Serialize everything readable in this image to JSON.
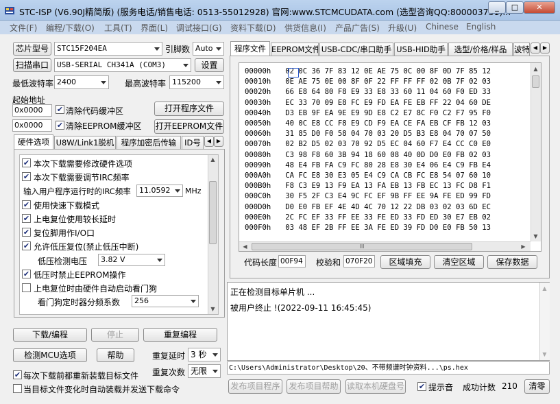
{
  "window": {
    "title": "STC-ISP (V6.90J精简版) (服务电话/销售电话: 0513-55012928) 官网:www.STCMCUDATA.com  (选型咨询QQ:800003751)..."
  },
  "menu": [
    "文件(F)",
    "编程/下载(O)",
    "工具(T)",
    "界面(L)",
    "调试接口(G)",
    "资料下载(D)",
    "供货信息(I)",
    "产品广告(S)",
    "升级(U)",
    "Chinese",
    "English"
  ],
  "left": {
    "chip_model_button": "芯片型号",
    "chip_model_value": "STC15F204EA",
    "pin_count_label": "引脚数",
    "pin_count_value": "Auto",
    "scan_port_button": "扫描串口",
    "port_value": "USB-SERIAL CH341A (COM3)",
    "settings_button": "设置",
    "min_baud_label": "最低波特率",
    "min_baud_value": "2400",
    "max_baud_label": "最高波特率",
    "max_baud_value": "115200",
    "start_addr_label": "起始地址",
    "code_addr": "0x0000",
    "clear_code_label": "清除代码缓冲区",
    "open_program_button": "打开程序文件",
    "eeprom_addr": "0x0000",
    "clear_eeprom_label": "清除EEPROM缓冲区",
    "open_eeprom_button": "打开EEPROM文件",
    "tabs": [
      "硬件选项",
      "U8W/Link1脱机",
      "程序加密后传输",
      "ID号"
    ],
    "options": {
      "opt1": "本次下载需要修改硬件选项",
      "opt2": "本次下载需要调节IRC频率",
      "irc_label": "输入用户程序运行时的IRC频率",
      "irc_value": "11.0592",
      "irc_unit": "MHz",
      "opt3": "使用快速下载模式",
      "opt4": "上电复位使用较长延时",
      "opt5": "复位脚用作I/O口",
      "opt6": "允许低压复位(禁止低压中断)",
      "lv_label": "低压检测电压",
      "lv_value": "3.82 V",
      "opt7": "低压时禁止EEPROM操作",
      "opt8": "上电复位时由硬件自动启动看门狗",
      "wdt_label": "看门狗定时器分频系数",
      "wdt_value": "256"
    },
    "download_button": "下载/编程",
    "stop_button": "停止",
    "reprogram_button": "重复编程",
    "check_mcu_button": "检测MCU选项",
    "help_button": "帮助",
    "repeat_delay_label": "重复延时",
    "repeat_delay_value": "3 秒",
    "repeat_count_label": "重复次数",
    "repeat_count_value": "无限",
    "reload_label": "每次下载前都重新装载目标文件",
    "auto_load_label": "当目标文件变化时自动装载并发送下载命令"
  },
  "right": {
    "tabs": [
      "程序文件",
      "EEPROM文件",
      "USB-CDC/串口助手",
      "USB-HID助手",
      "选型/价格/样品",
      "波特"
    ],
    "hex": {
      "rows": [
        [
          "00000h",
          "02 0C 36 7F 83 12 0E AE 75 0C 00 8F 0D 7F 85 12"
        ],
        [
          "00010h",
          "0E AE 75 0E 00 8F 0F 22 FF FF FF 02 0B 7F 02 03"
        ],
        [
          "00020h",
          "66 E8 64 80 F8 E9 33 E8 33 60 11 04 60 F0 ED 33"
        ],
        [
          "00030h",
          "EC 33 70 09 E8 FC E9 FD EA FE EB FF 22 04 60 DE"
        ],
        [
          "00040h",
          "D3 EB 9F EA 9E E9 9D E8 C2 E7 8C F0 C2 F7 95 F0"
        ],
        [
          "00050h",
          "40 0C E8 CC F8 E9 CD F9 EA CE FA EB CF FB 12 03"
        ],
        [
          "00060h",
          "31 85 D0 F0 58 04 70 03 20 D5 B3 E8 04 70 07 50"
        ],
        [
          "00070h",
          "02 B2 D5 02 03 70 92 D5 EC 04 60 F7 E4 CC C0 E0"
        ],
        [
          "00080h",
          "C3 98 F8 60 3B 94 18 60 08 40 0D D0 E0 FB 02 03"
        ],
        [
          "00090h",
          "48 E4 FB FA C9 FC 80 28 E8 30 E4 06 E4 C9 FB E4"
        ],
        [
          "000A0h",
          "CA FC E8 30 E3 05 E4 C9 CA CB FC E8 54 07 60 10"
        ],
        [
          "000B0h",
          "F8 C3 E9 13 F9 EA 13 FA EB 13 FB EC 13 FC D8 F1"
        ],
        [
          "000C0h",
          "30 F5 2F C3 E4 9C FC EF 9B FF EE 9A FE ED 99 FD"
        ],
        [
          "000D0h",
          "D0 E0 FB EF 4E 4D 4C 70 12 22 DB 03 02 03 6D EC"
        ],
        [
          "000E0h",
          "2C FC EF 33 FF EE 33 FE ED 33 FD ED 30 E7 EB 02"
        ],
        [
          "000F0h",
          "03 48 EF 2B FF EE 3A FE ED 39 FD D0 E0 FB 50 13"
        ]
      ],
      "scrollbar_grip": "III"
    },
    "code_len_label": "代码长度",
    "code_len_value": "00F94",
    "checksum_label": "校验和",
    "checksum_value": "070F20",
    "fill_button": "区域填充",
    "clear_button": "清空区域",
    "save_button": "保存数据",
    "log": [
      "正在检测目标单片机 ...",
      "被用户终止 !(2022-09-11 16:45:45)"
    ],
    "file_path": "C:\\Users\\Administrator\\Desktop\\20、不带频谱时钟资料...\\ps.hex",
    "publish_program_button": "发布项目程序",
    "publish_help_button": "发布项目帮助",
    "read_disk_button": "读取本机硬盘号",
    "sound_label": "提示音",
    "success_label": "成功计数",
    "success_value": "210",
    "clear_count_button": "清零"
  }
}
